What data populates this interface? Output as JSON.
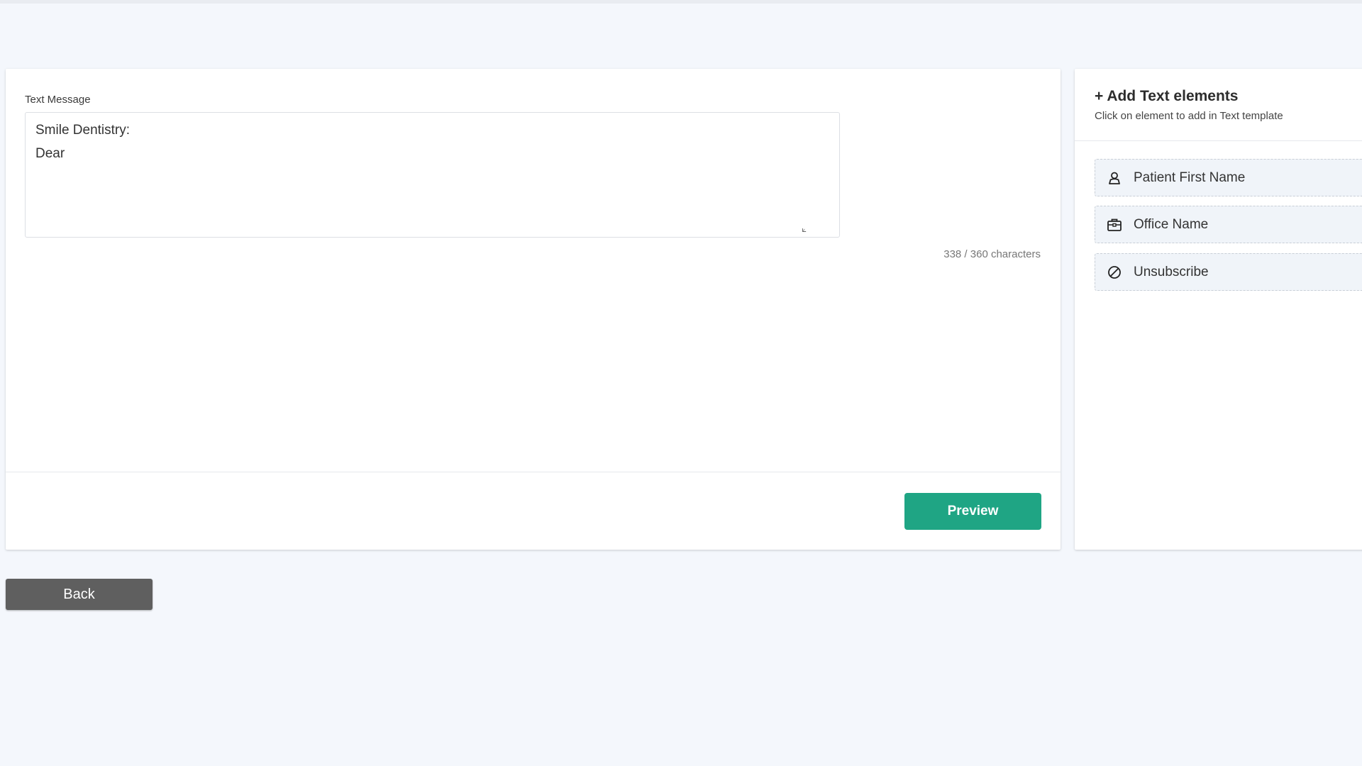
{
  "editor": {
    "label": "Text Message",
    "message_lines": [
      "Smile Dentistry:",
      "Dear"
    ],
    "char_count": "338 / 360 characters",
    "preview_label": "Preview"
  },
  "elements_panel": {
    "title": "+ Add Text elements",
    "subtitle": "Click on element to add in Text template",
    "items": [
      {
        "label": "Patient First Name",
        "icon": "person-icon"
      },
      {
        "label": "Office Name",
        "icon": "briefcase-icon"
      },
      {
        "label": "Unsubscribe",
        "icon": "block-icon"
      }
    ]
  },
  "footer": {
    "back_label": "Back"
  },
  "colors": {
    "page_background": "#f4f7fc",
    "preview_button": "#1fa584",
    "back_button": "#5f5f5f",
    "chip_background": "#f0f4f9"
  }
}
